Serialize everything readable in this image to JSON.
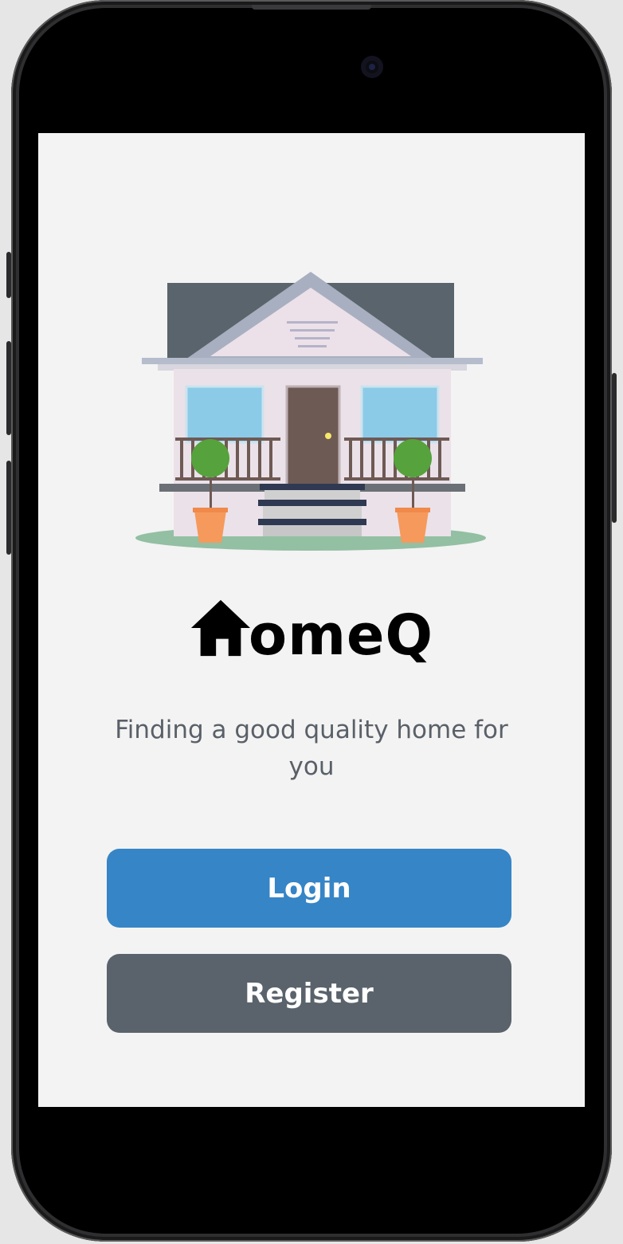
{
  "app": {
    "brand_suffix": "omeQ",
    "brand_logo_icon": "house-h-icon",
    "tagline": "Finding a good quality home for you"
  },
  "actions": {
    "login_label": "Login",
    "register_label": "Register"
  },
  "colors": {
    "login_button": "#3685c6",
    "register_button": "#5a636b",
    "screen_background": "#f3f3f3",
    "tagline_text": "#5a6068"
  },
  "icons": {
    "hero_illustration": "house-illustration"
  }
}
